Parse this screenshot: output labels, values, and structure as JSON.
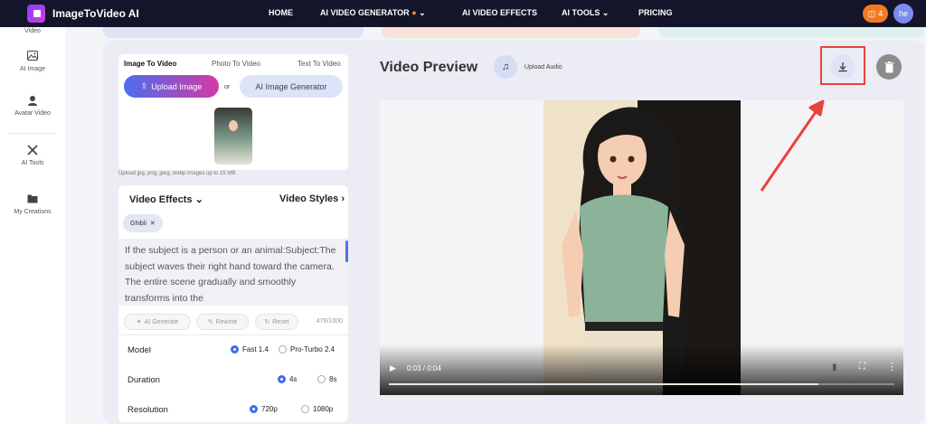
{
  "brand": {
    "name": "ImageToVideo AI"
  },
  "nav": {
    "links": [
      "HOME",
      "AI VIDEO GENERATOR",
      "AI VIDEO EFFECTS",
      "AI TOOLS",
      "PRICING"
    ],
    "credits": "4",
    "avatar": "he"
  },
  "sidebar": {
    "items": [
      {
        "label": "Video"
      },
      {
        "label": "AI Image"
      },
      {
        "label": "Avatar Video"
      },
      {
        "label": "AI Tools"
      },
      {
        "label": "My Creations"
      }
    ]
  },
  "left_panel": {
    "tabs": [
      "Image To Video",
      "Photo To Video",
      "Text To Video"
    ],
    "upload_label": "Upload Image",
    "or_label": "or",
    "generator_label": "AI Image Generator",
    "hint": "Upload jpg, png, jpeg, webp images up to 15 MB",
    "effects_label": "Video Effects",
    "styles_label": "Video Styles",
    "chip": "Ghibli",
    "prompt": "If the subject is a person or an animal:Subject:The subject waves their right hand toward the camera. The entire scene gradually and smoothly transforms into the",
    "actions": [
      "AI Generate",
      "Rewrite",
      "Reset"
    ],
    "char_count": "476/1000",
    "model": {
      "label": "Model",
      "options": [
        "Fast 1.4",
        "Pro-Turbo 2.4"
      ],
      "selected": "Fast 1.4"
    },
    "duration": {
      "label": "Duration",
      "options": [
        "4s",
        "8s"
      ],
      "selected": "4s"
    },
    "resolution": {
      "label": "Resolution",
      "options": [
        "720p",
        "1080p"
      ],
      "selected": "720p"
    }
  },
  "preview": {
    "title": "Video Preview",
    "audio_label": "Upload Audio",
    "time": "0:03 / 0:04",
    "progress": 0.85
  },
  "colors": {
    "accent": "#3b6cf0",
    "highlight": "#e8443a",
    "nav_bg": "#14142a"
  }
}
